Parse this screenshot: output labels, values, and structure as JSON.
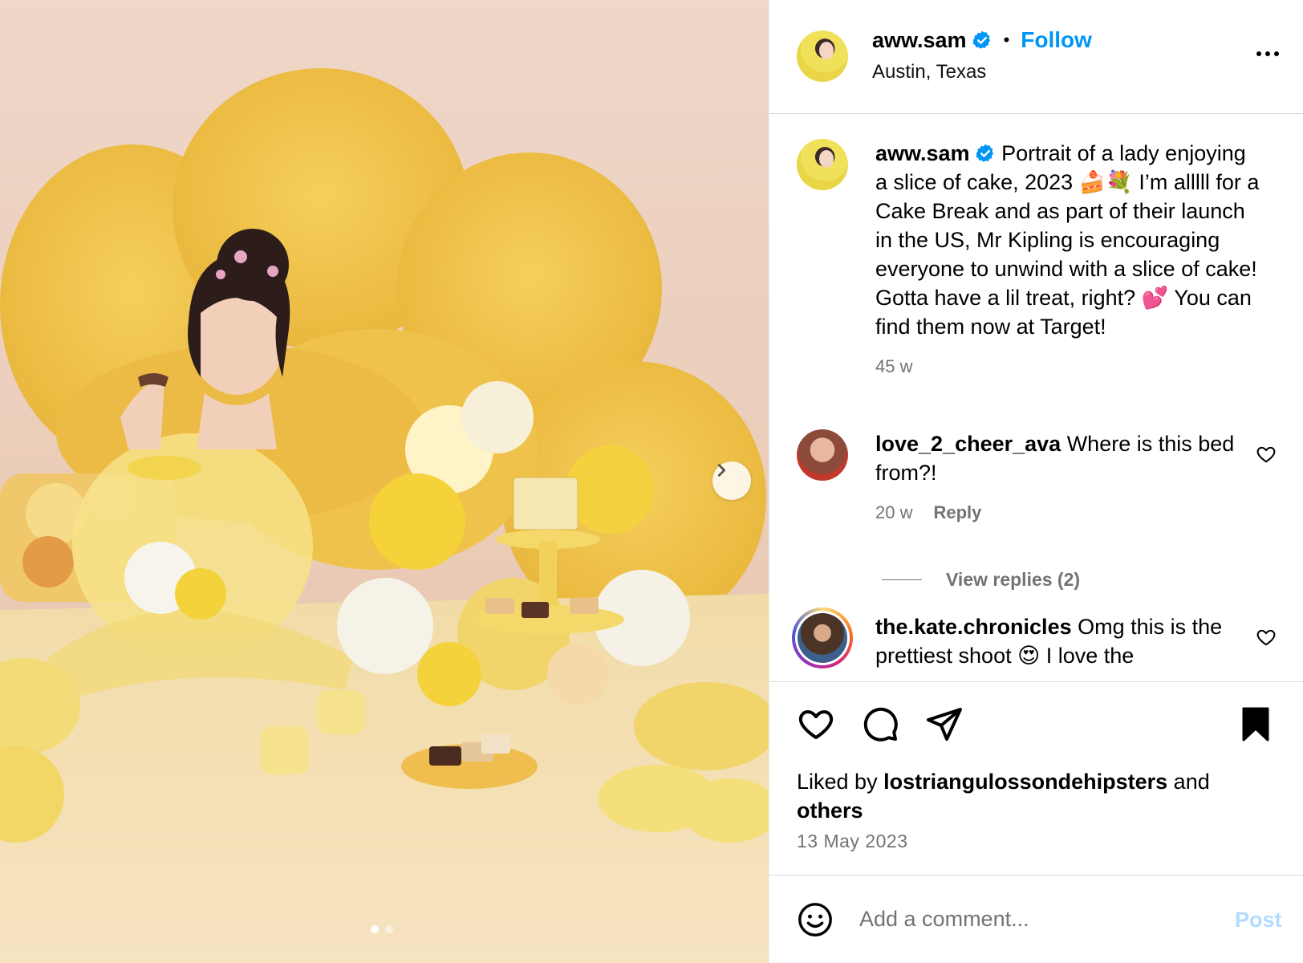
{
  "theme": {
    "accent": "#0095f6",
    "verified": "#0095f6",
    "muted": "#737373",
    "post_disabled": "#b3dbff"
  },
  "post": {
    "author": "aww.sam",
    "verified": true,
    "follow_label": "Follow",
    "location": "Austin, Texas",
    "more_icon": "more-horizontal-icon",
    "image": {
      "carousel_total": 2,
      "carousel_index": 1,
      "next_icon": "chevron-right-icon"
    }
  },
  "caption": {
    "author": "aww.sam",
    "text": "Portrait of a lady enjoying a slice of cake, 2023 🍰💐 I’m alllll for a Cake Break and as part of their launch in the US, Mr Kipling is encouraging everyone to unwind with a slice of cake! Gotta have a lil treat, right? 💕 You can find them now at Target!",
    "age": "45 w"
  },
  "comments": [
    {
      "author": "love_2_cheer_ava",
      "text": "Where is this bed from?!",
      "age": "20 w",
      "reply_label": "Reply",
      "view_replies_label": "View replies (2)"
    },
    {
      "author": "the.kate.chronicles",
      "text": "Omg this is the prettiest shoot 😍 I love the"
    }
  ],
  "actions": {
    "like_icon": "heart-icon",
    "comment_icon": "comment-icon",
    "share_icon": "share-icon",
    "save_icon": "bookmark-icon"
  },
  "likes": {
    "prefix": "Liked by",
    "user": "lostriangulossondehipsters",
    "and": "and",
    "others": "others"
  },
  "date": "13 May 2023",
  "composer": {
    "placeholder": "Add a comment...",
    "post_label": "Post",
    "emoji_icon": "emoji-icon"
  }
}
